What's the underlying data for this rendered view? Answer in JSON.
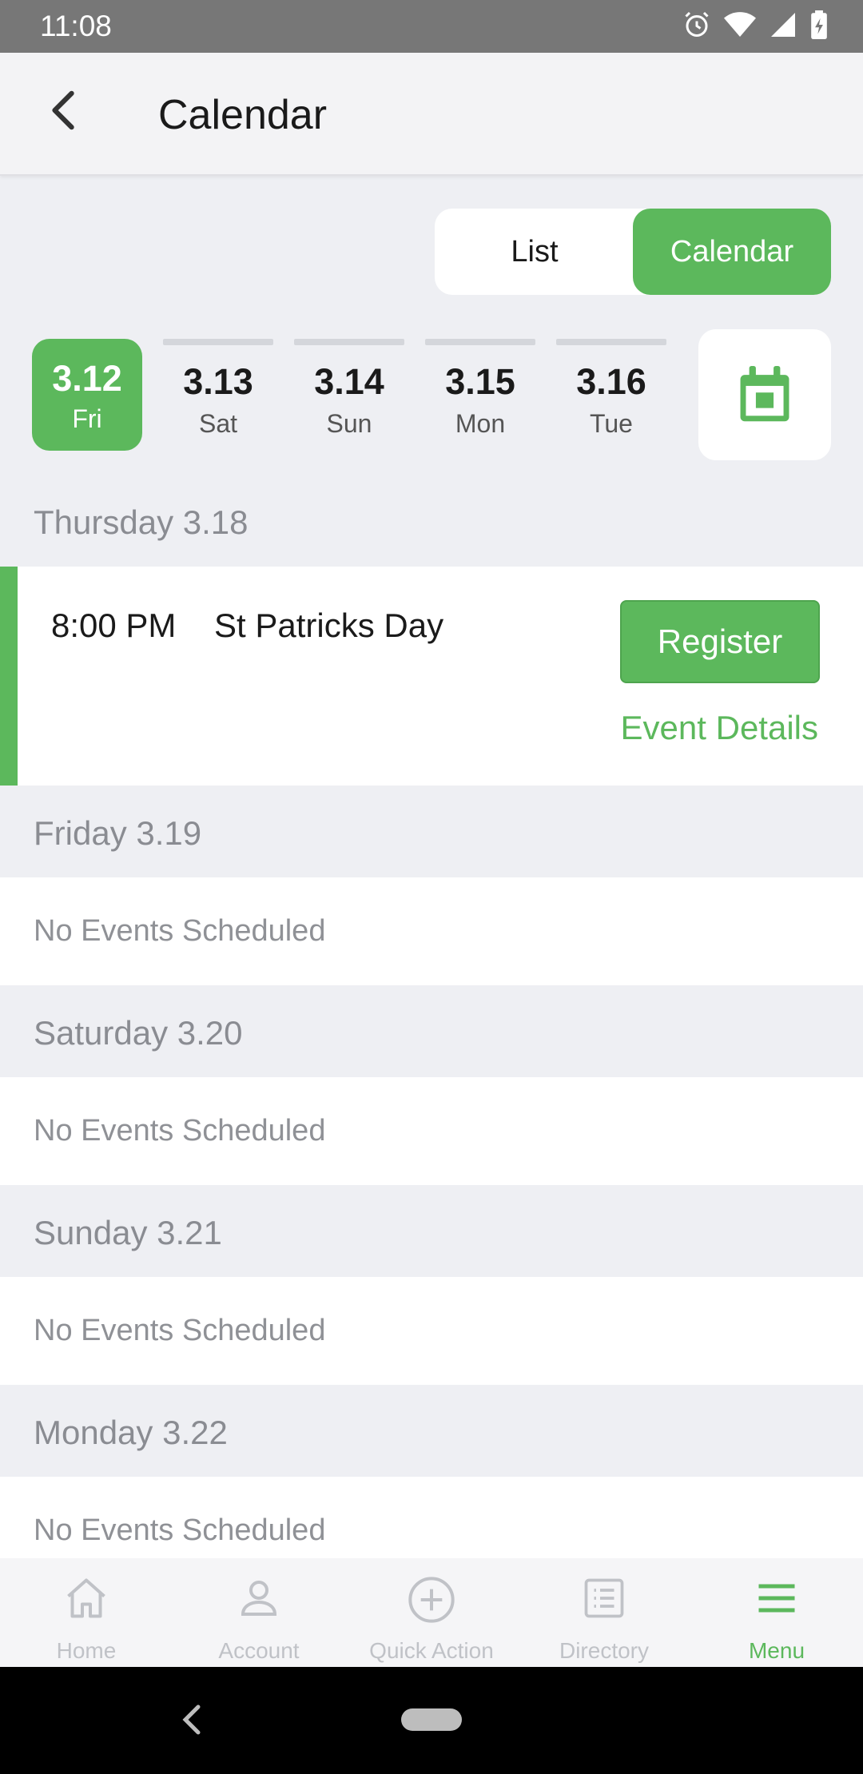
{
  "status_bar": {
    "time": "11:08"
  },
  "app_bar": {
    "title": "Calendar"
  },
  "view_toggle": {
    "list_label": "List",
    "calendar_label": "Calendar",
    "selected": "Calendar"
  },
  "date_strip": [
    {
      "date": "3.12",
      "weekday": "Fri",
      "selected": true
    },
    {
      "date": "3.13",
      "weekday": "Sat",
      "selected": false
    },
    {
      "date": "3.14",
      "weekday": "Sun",
      "selected": false
    },
    {
      "date": "3.15",
      "weekday": "Mon",
      "selected": false
    },
    {
      "date": "3.16",
      "weekday": "Tue",
      "selected": false
    }
  ],
  "days": [
    {
      "heading": "Thursday 3.18",
      "event": {
        "time": "8:00 PM",
        "title": "St Patricks Day",
        "register_label": "Register",
        "details_label": "Event Details"
      }
    },
    {
      "heading": "Friday 3.19",
      "empty_text": "No Events Scheduled"
    },
    {
      "heading": "Saturday 3.20",
      "empty_text": "No Events Scheduled"
    },
    {
      "heading": "Sunday 3.21",
      "empty_text": "No Events Scheduled"
    },
    {
      "heading": "Monday 3.22",
      "empty_text": "No Events Scheduled"
    }
  ],
  "bottom_nav": [
    {
      "label": "Home",
      "icon": "home-icon",
      "active": false
    },
    {
      "label": "Account",
      "icon": "account-icon",
      "active": false
    },
    {
      "label": "Quick Action",
      "icon": "plus-circle-icon",
      "active": false
    },
    {
      "label": "Directory",
      "icon": "directory-icon",
      "active": false
    },
    {
      "label": "Menu",
      "icon": "menu-icon",
      "active": true
    }
  ],
  "colors": {
    "accent": "#5cb85c",
    "muted_text": "#8a8c92",
    "section_bg": "#eeeff3",
    "inactive_nav": "#c0c2c7"
  }
}
